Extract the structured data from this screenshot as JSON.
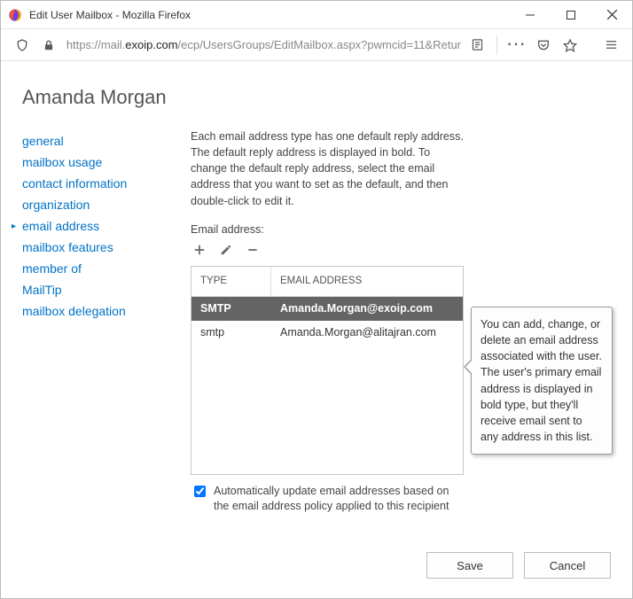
{
  "window": {
    "title": "Edit User Mailbox - Mozilla Firefox",
    "url_pre": "https://mail.",
    "url_bold": "exoip.com",
    "url_post": "/ecp/UsersGroups/EditMailbox.aspx?pwmcid=11&Retur"
  },
  "page": {
    "title": "Amanda Morgan"
  },
  "nav": {
    "items": [
      {
        "label": "general",
        "selected": false
      },
      {
        "label": "mailbox usage",
        "selected": false
      },
      {
        "label": "contact information",
        "selected": false
      },
      {
        "label": "organization",
        "selected": false
      },
      {
        "label": "email address",
        "selected": true
      },
      {
        "label": "mailbox features",
        "selected": false
      },
      {
        "label": "member of",
        "selected": false
      },
      {
        "label": "MailTip",
        "selected": false
      },
      {
        "label": "mailbox delegation",
        "selected": false
      }
    ]
  },
  "main": {
    "intro": "Each email address type has one default reply address. The default reply address is displayed in bold. To change the default reply address, select the email address that you want to set as the default, and then double-click to edit it.",
    "field_label": "Email address:",
    "table": {
      "headers": {
        "type": "TYPE",
        "address": "EMAIL ADDRESS"
      },
      "rows": [
        {
          "type": "SMTP",
          "address": "Amanda.Morgan@exoip.com",
          "selected": true
        },
        {
          "type": "smtp",
          "address": "Amanda.Morgan@alitajran.com",
          "selected": false
        }
      ]
    },
    "checkbox": {
      "checked": true,
      "label": "Automatically update email addresses based on the email address policy applied to this recipient"
    }
  },
  "tooltip": "You can add, change, or delete an email address associated with the user. The user's primary email address is displayed in bold type, but they'll receive email sent to any address in this list.",
  "footer": {
    "save": "Save",
    "cancel": "Cancel"
  }
}
